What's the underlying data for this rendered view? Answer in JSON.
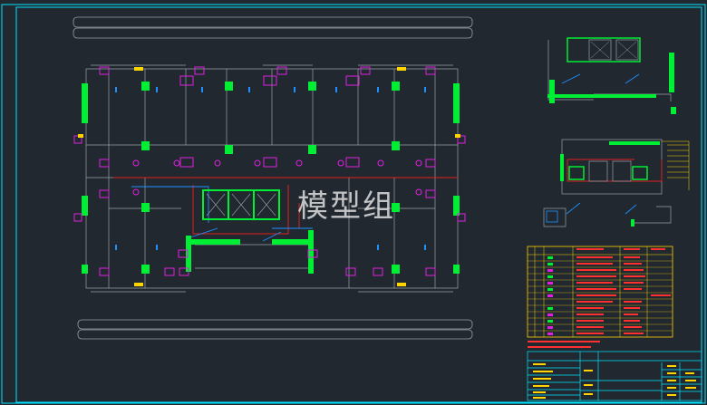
{
  "watermark": "模型组",
  "colors": {
    "background": "#212830",
    "frame": "#00e5ff",
    "wall": "#9aa0a6",
    "column": "#00ee33",
    "fixture": "#e020e0",
    "sprinkler": "#1e90ff",
    "pipe_red": "#e02020",
    "legend_border": "#ffd400",
    "legend_text": "#ff3030"
  }
}
